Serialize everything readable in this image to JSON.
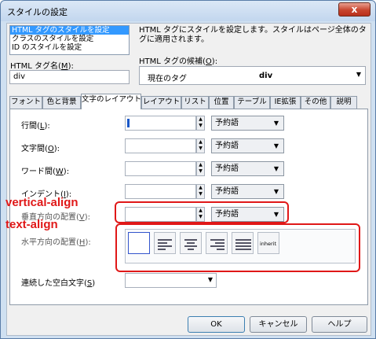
{
  "window": {
    "title": "スタイルの設定",
    "close_label": "x"
  },
  "categories": [
    {
      "label": "HTML タグのスタイルを設定",
      "selected": true
    },
    {
      "label": "クラスのスタイルを設定",
      "selected": false
    },
    {
      "label": "ID のスタイルを設定",
      "selected": false
    }
  ],
  "tag_name": {
    "label_prefix": "HTML タグ名(",
    "accel": "M",
    "label_suffix": "):",
    "value": "div"
  },
  "description": "HTML タグにスタイルを設定します。スタイルはページ全体のタグに適用されます。",
  "candidates": {
    "label_prefix": "HTML タグの候補(",
    "accel": "O",
    "label_suffix": "):",
    "left": "現在のタグ",
    "value": "div"
  },
  "tabs": [
    "フォント",
    "色と背景",
    "文字のレイアウト",
    "レイアウト",
    "リスト",
    "位置",
    "テーブル",
    "IE拡張",
    "その他",
    "説明"
  ],
  "active_tab": "文字のレイアウト",
  "fields": {
    "line_height": {
      "prefix": "行間(",
      "accel": "L",
      "suffix": "):",
      "unit": "予約語"
    },
    "letter_spacing": {
      "prefix": "文字間(",
      "accel": "O",
      "suffix": "):",
      "unit": "予約語"
    },
    "word_spacing": {
      "prefix": "ワード間(",
      "accel": "W",
      "suffix": "):",
      "unit": "予約語"
    },
    "text_indent": {
      "prefix": "インデント(",
      "accel": "I",
      "suffix": "):",
      "unit": "予約語"
    },
    "vertical_align": {
      "prefix": "垂直方向の配置(",
      "accel": "V",
      "suffix": "):",
      "unit": "予約語"
    },
    "text_align": {
      "prefix": "水平方向の配置(",
      "accel": "H",
      "suffix": "):"
    },
    "white_space": {
      "prefix": "連続した空白文字(",
      "accel": "S",
      "suffix": ")"
    }
  },
  "align_options": [
    "none",
    "left",
    "center",
    "right",
    "justify",
    "inherit"
  ],
  "align_inherit_label": "inherit",
  "annotations": {
    "vertical": "vertical-align",
    "text": "text-align"
  },
  "annotation_color": "#e01818",
  "buttons": {
    "ok": "OK",
    "cancel": "キャンセル",
    "help": "ヘルプ"
  }
}
